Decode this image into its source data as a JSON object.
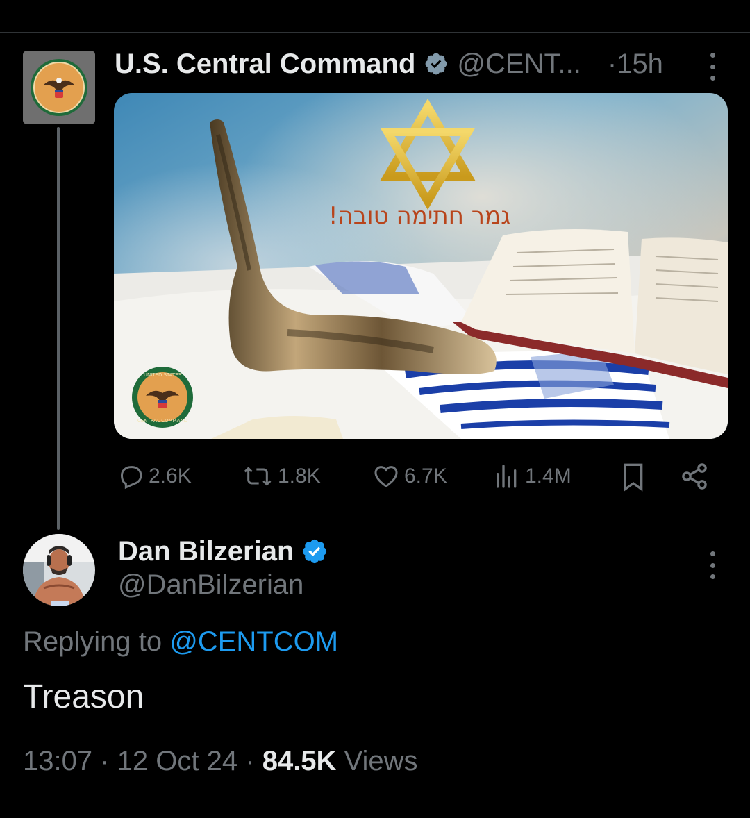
{
  "parent_tweet": {
    "author_name": "U.S. Central Command",
    "handle": "@CENT...",
    "separator": "·",
    "time": "15h",
    "media": {
      "hebrew_caption": "גמר חתימה טובה!",
      "seal_text_top": "UNITED STATES",
      "seal_text_bottom": "CENTRAL COMMAND"
    },
    "stats": {
      "replies": "2.6K",
      "reposts": "1.8K",
      "likes": "6.7K",
      "views": "1.4M"
    }
  },
  "reply_tweet": {
    "author_name": "Dan Bilzerian",
    "handle": "@DanBilzerian",
    "replying_prefix": "Replying to ",
    "replying_to": "@CENTCOM",
    "text": "Treason",
    "time": "13:07",
    "date": "12 Oct 24",
    "views_count": "84.5K",
    "views_label": "Views",
    "separator": "·"
  },
  "colors": {
    "background": "#000000",
    "text": "#e7e9ea",
    "muted": "#71767b",
    "link": "#1d9bf0",
    "verified_blue": "#1d9bf0",
    "verified_gray": "#829aab"
  }
}
